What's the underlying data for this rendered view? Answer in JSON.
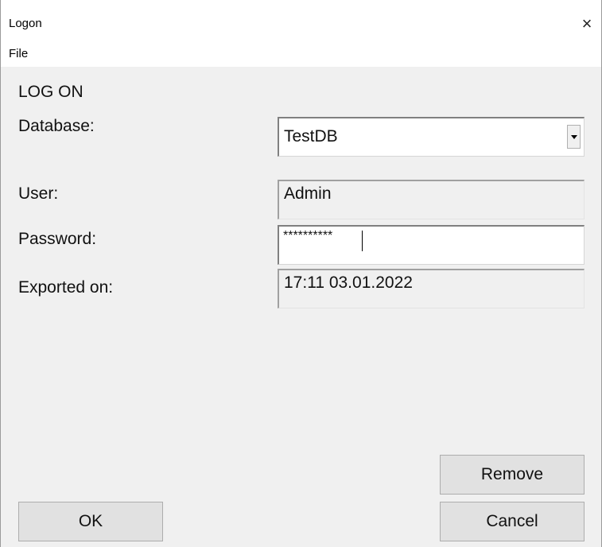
{
  "window": {
    "title": "Logon",
    "close_glyph": "×"
  },
  "menu": {
    "items": [
      {
        "label": "File"
      }
    ]
  },
  "form": {
    "heading": "LOG ON",
    "database": {
      "label": "Database:",
      "value": "TestDB"
    },
    "user": {
      "label": "User:",
      "value": "Admin"
    },
    "password": {
      "label": "Password:",
      "value": "**********"
    },
    "exported_on": {
      "label": "Exported on:",
      "value": "17:11 03.01.2022"
    }
  },
  "buttons": {
    "remove": "Remove",
    "ok": "OK",
    "cancel": "Cancel"
  },
  "icons": {
    "close": "close-icon",
    "dropdown": "chevron-down-icon"
  }
}
